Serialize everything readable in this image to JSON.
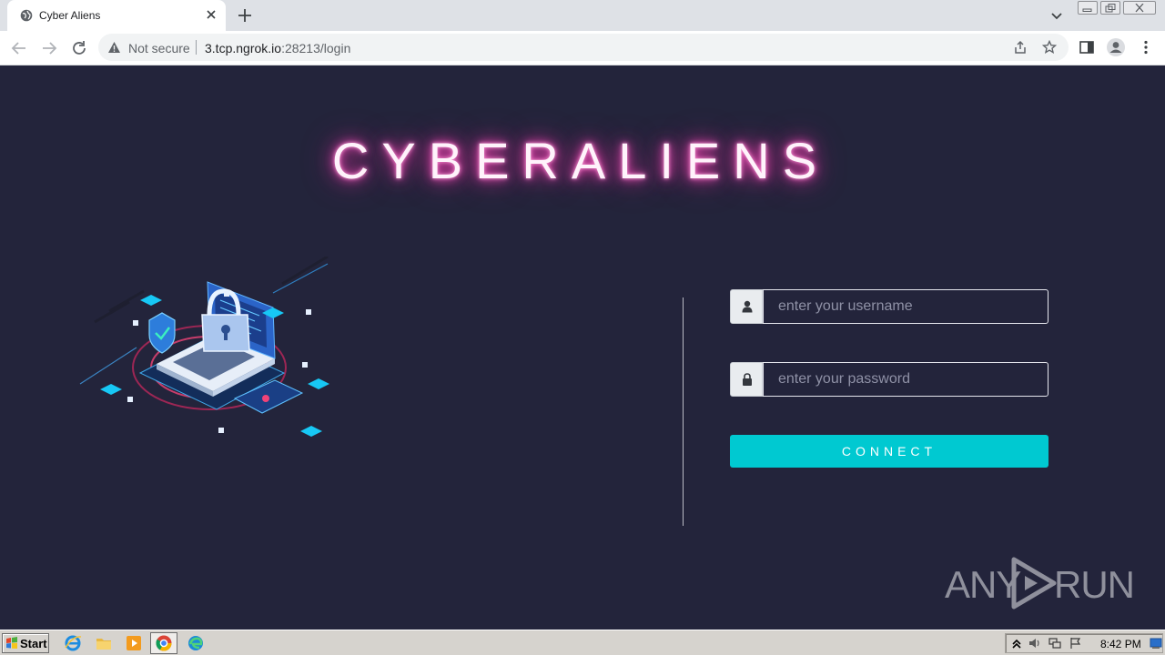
{
  "browser": {
    "tab_title": "Cyber Aliens",
    "security_label": "Not secure",
    "url_host": "3.tcp.ngrok.io",
    "url_rest": ":28213/login"
  },
  "page": {
    "brand": "CYBERALIENS",
    "username_placeholder": "enter your username",
    "password_placeholder": "enter your password",
    "connect_label": "CONNECT",
    "accent_color": "#00c9d1",
    "neon_color": "#ff4fc0"
  },
  "watermark": {
    "left": "ANY",
    "right": "RUN"
  },
  "taskbar": {
    "start_label": "Start",
    "clock": "8:42 PM"
  }
}
